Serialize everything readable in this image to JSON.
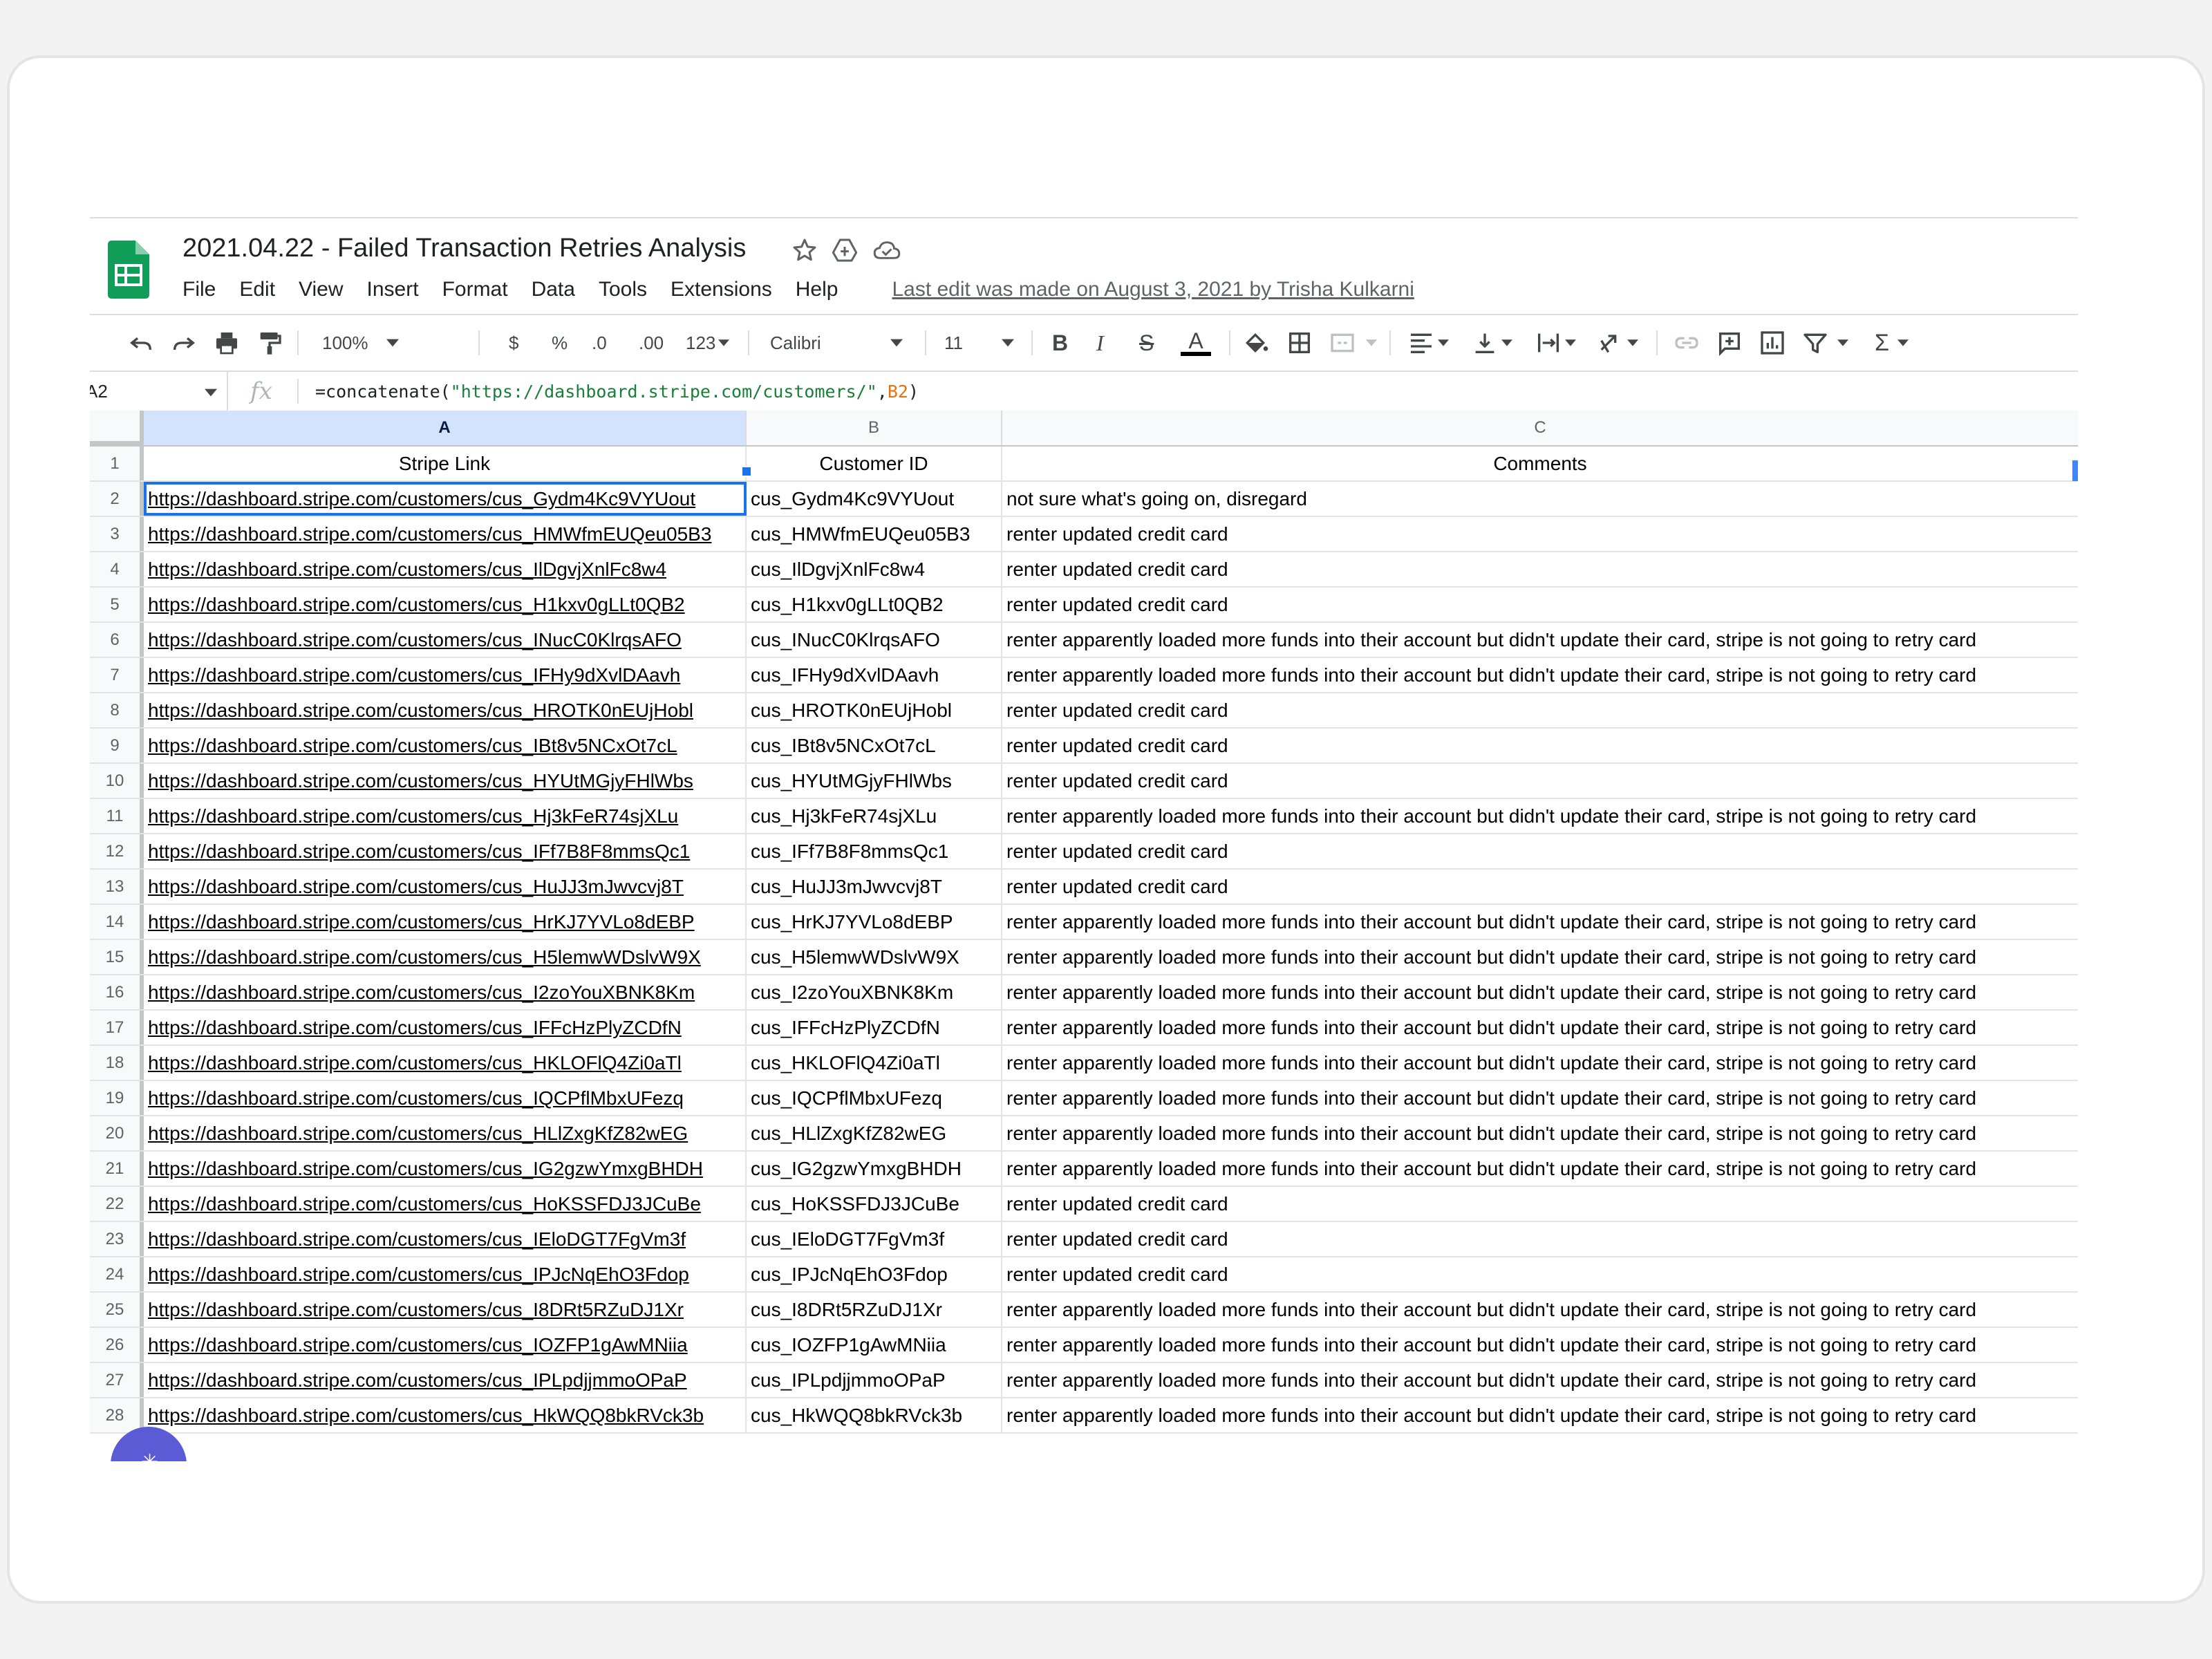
{
  "document": {
    "title": "2021.04.22 - Failed Transaction Retries Analysis",
    "last_edit": "Last edit was made on August 3, 2021 by Trisha Kulkarni"
  },
  "menu": [
    "File",
    "Edit",
    "View",
    "Insert",
    "Format",
    "Data",
    "Tools",
    "Extensions",
    "Help"
  ],
  "toolbar": {
    "zoom": "100%",
    "currency": "$",
    "percent": "%",
    "decrease_decimals": ".0",
    "increase_decimals": ".00",
    "number_format": "123",
    "font": "Calibri",
    "font_size": "11",
    "bold": "B",
    "italic": "I",
    "strike": "S",
    "text_color": "A",
    "sum": "Σ"
  },
  "formula_bar": {
    "cell_ref": "A2",
    "fx": "fx",
    "formula_fn": "=concatenate(",
    "formula_str": "\"https://dashboard.stripe.com/customers/\"",
    "formula_sep": ",",
    "formula_ref": "B2",
    "formula_close": ")"
  },
  "columns": [
    {
      "letter": "A",
      "header": "Stripe Link"
    },
    {
      "letter": "B",
      "header": "Customer ID"
    },
    {
      "letter": "C",
      "header": "Comments"
    }
  ],
  "rows": [
    {
      "num": "2",
      "link": "https://dashboard.stripe.com/customers/cus_Gydm4Kc9VYUout",
      "id": "cus_Gydm4Kc9VYUout",
      "comment": "not sure what's going on, disregard"
    },
    {
      "num": "3",
      "link": "https://dashboard.stripe.com/customers/cus_HMWfmEUQeu05B3",
      "id": "cus_HMWfmEUQeu05B3",
      "comment": "renter updated credit card"
    },
    {
      "num": "4",
      "link": "https://dashboard.stripe.com/customers/cus_IlDgvjXnlFc8w4",
      "id": "cus_IlDgvjXnlFc8w4",
      "comment": "renter updated credit card"
    },
    {
      "num": "5",
      "link": "https://dashboard.stripe.com/customers/cus_H1kxv0gLLt0QB2",
      "id": "cus_H1kxv0gLLt0QB2",
      "comment": "renter updated credit card"
    },
    {
      "num": "6",
      "link": "https://dashboard.stripe.com/customers/cus_INucC0KlrqsAFO",
      "id": "cus_INucC0KlrqsAFO",
      "comment": "renter apparently loaded more funds into their account but didn't update their card, stripe is not going to retry card"
    },
    {
      "num": "7",
      "link": "https://dashboard.stripe.com/customers/cus_IFHy9dXvlDAavh",
      "id": "cus_IFHy9dXvlDAavh",
      "comment": "renter apparently loaded more funds into their account but didn't update their card, stripe is not going to retry card"
    },
    {
      "num": "8",
      "link": "https://dashboard.stripe.com/customers/cus_HROTK0nEUjHobl",
      "id": "cus_HROTK0nEUjHobl",
      "comment": "renter updated credit card"
    },
    {
      "num": "9",
      "link": "https://dashboard.stripe.com/customers/cus_IBt8v5NCxOt7cL",
      "id": "cus_IBt8v5NCxOt7cL",
      "comment": "renter updated credit card"
    },
    {
      "num": "10",
      "link": "https://dashboard.stripe.com/customers/cus_HYUtMGjyFHlWbs",
      "id": "cus_HYUtMGjyFHlWbs",
      "comment": "renter updated credit card"
    },
    {
      "num": "11",
      "link": "https://dashboard.stripe.com/customers/cus_Hj3kFeR74sjXLu",
      "id": "cus_Hj3kFeR74sjXLu",
      "comment": "renter apparently loaded more funds into their account but didn't update their card, stripe is not going to retry card"
    },
    {
      "num": "12",
      "link": "https://dashboard.stripe.com/customers/cus_IFf7B8F8mmsQc1",
      "id": "cus_IFf7B8F8mmsQc1",
      "comment": "renter updated credit card"
    },
    {
      "num": "13",
      "link": "https://dashboard.stripe.com/customers/cus_HuJJ3mJwvcvj8T",
      "id": "cus_HuJJ3mJwvcvj8T",
      "comment": "renter updated credit card"
    },
    {
      "num": "14",
      "link": "https://dashboard.stripe.com/customers/cus_HrKJ7YVLo8dEBP",
      "id": "cus_HrKJ7YVLo8dEBP",
      "comment": "renter apparently loaded more funds into their account but didn't update their card, stripe is not going to retry card"
    },
    {
      "num": "15",
      "link": "https://dashboard.stripe.com/customers/cus_H5lemwWDslvW9X",
      "id": "cus_H5lemwWDslvW9X",
      "comment": "renter apparently loaded more funds into their account but didn't update their card, stripe is not going to retry card"
    },
    {
      "num": "16",
      "link": "https://dashboard.stripe.com/customers/cus_I2zoYouXBNK8Km",
      "id": "cus_I2zoYouXBNK8Km",
      "comment": "renter apparently loaded more funds into their account but didn't update their card, stripe is not going to retry card"
    },
    {
      "num": "17",
      "link": "https://dashboard.stripe.com/customers/cus_IFFcHzPlyZCDfN",
      "id": "cus_IFFcHzPlyZCDfN",
      "comment": "renter apparently loaded more funds into their account but didn't update their card, stripe is not going to retry card"
    },
    {
      "num": "18",
      "link": "https://dashboard.stripe.com/customers/cus_HKLOFlQ4Zi0aTl",
      "id": "cus_HKLOFlQ4Zi0aTl",
      "comment": "renter apparently loaded more funds into their account but didn't update their card, stripe is not going to retry card"
    },
    {
      "num": "19",
      "link": "https://dashboard.stripe.com/customers/cus_IQCPflMbxUFezq",
      "id": "cus_IQCPflMbxUFezq",
      "comment": "renter apparently loaded more funds into their account but didn't update their card, stripe is not going to retry card"
    },
    {
      "num": "20",
      "link": "https://dashboard.stripe.com/customers/cus_HLlZxgKfZ82wEG",
      "id": "cus_HLlZxgKfZ82wEG",
      "comment": "renter apparently loaded more funds into their account but didn't update their card, stripe is not going to retry card"
    },
    {
      "num": "21",
      "link": "https://dashboard.stripe.com/customers/cus_IG2gzwYmxgBHDH",
      "id": "cus_IG2gzwYmxgBHDH",
      "comment": "renter apparently loaded more funds into their account but didn't update their card, stripe is not going to retry card"
    },
    {
      "num": "22",
      "link": "https://dashboard.stripe.com/customers/cus_HoKSSFDJ3JCuBe",
      "id": "cus_HoKSSFDJ3JCuBe",
      "comment": "renter updated credit card"
    },
    {
      "num": "23",
      "link": "https://dashboard.stripe.com/customers/cus_IEloDGT7FgVm3f",
      "id": "cus_IEloDGT7FgVm3f",
      "comment": "renter updated credit card"
    },
    {
      "num": "24",
      "link": "https://dashboard.stripe.com/customers/cus_IPJcNqEhO3Fdop",
      "id": "cus_IPJcNqEhO3Fdop",
      "comment": "renter updated credit card"
    },
    {
      "num": "25",
      "link": "https://dashboard.stripe.com/customers/cus_I8DRt5RZuDJ1Xr",
      "id": "cus_I8DRt5RZuDJ1Xr",
      "comment": "renter apparently loaded more funds into their account but didn't update their card, stripe is not going to retry card"
    },
    {
      "num": "26",
      "link": "https://dashboard.stripe.com/customers/cus_IOZFP1gAwMNiia",
      "id": "cus_IOZFP1gAwMNiia",
      "comment": "renter apparently loaded more funds into their account but didn't update their card, stripe is not going to retry card"
    },
    {
      "num": "27",
      "link": "https://dashboard.stripe.com/customers/cus_IPLpdjjmmoOPaP",
      "id": "cus_IPLpdjjmmoOPaP",
      "comment": "renter apparently loaded more funds into their account but didn't update their card, stripe is not going to retry card"
    },
    {
      "num": "28",
      "link": "https://dashboard.stripe.com/customers/cus_HkWQQ8bkRVck3b",
      "id": "cus_HkWQQ8bkRVck3b",
      "comment": "renter apparently loaded more funds into their account but didn't update their card, stripe is not going to retry card"
    }
  ],
  "colors": {
    "selection": "#1a73e8",
    "sheets_green": "#0f9d58",
    "fab": "#5b5bd6",
    "formula_string": "#188038",
    "formula_ref": "#e8710a"
  }
}
